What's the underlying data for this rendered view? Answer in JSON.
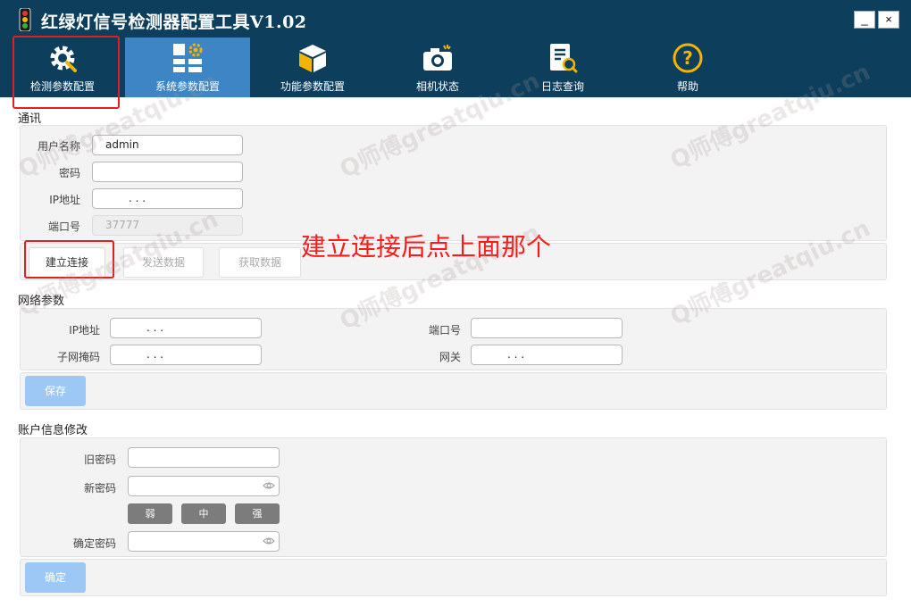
{
  "window": {
    "title": "红绿灯信号检测器配置工具V1.02",
    "minimize_label": "_",
    "close_label": "×"
  },
  "toolbar": {
    "tabs": [
      {
        "label": "检测参数配置",
        "icon": "gear-wrench-icon"
      },
      {
        "label": "系统参数配置",
        "icon": "grid-gear-icon"
      },
      {
        "label": "功能参数配置",
        "icon": "cube-icon"
      },
      {
        "label": "相机状态",
        "icon": "camera-icon"
      },
      {
        "label": "日志查询",
        "icon": "log-search-icon"
      },
      {
        "label": "帮助",
        "icon": "help-icon"
      }
    ],
    "active_index": 1
  },
  "comm": {
    "title": "通讯",
    "username_label": "用户名称",
    "username_value": "admin",
    "password_label": "密码",
    "password_value": "",
    "ip_label": "IP地址",
    "ip_dots": ".          .          .",
    "port_label": "端口号",
    "port_value": "37777",
    "connect_button": "建立连接",
    "send_button": "发送数据",
    "fetch_button": "获取数据"
  },
  "network": {
    "title": "网络参数",
    "ip_label": "IP地址",
    "ip_dots": ".          .          .",
    "port_label": "端口号",
    "port_value": "",
    "mask_label": "子网掩码",
    "mask_dots": ".          .          .",
    "gateway_label": "网关",
    "gateway_dots": ".          .          .",
    "save_button": "保存"
  },
  "account": {
    "title": "账户信息修改",
    "old_password_label": "旧密码",
    "new_password_label": "新密码",
    "strength": [
      "弱",
      "中",
      "强"
    ],
    "confirm_password_label": "确定密码",
    "confirm_button": "确定"
  },
  "annotation": {
    "text": "建立连接后点上面那个",
    "color": "#ff1a1a"
  },
  "watermark": {
    "text": "Q师傅greatqiu.cn"
  },
  "colors": {
    "header_bg": "#0d3e5c",
    "active_tab": "#3d85c4",
    "accent_button": "#9dc8f6"
  }
}
